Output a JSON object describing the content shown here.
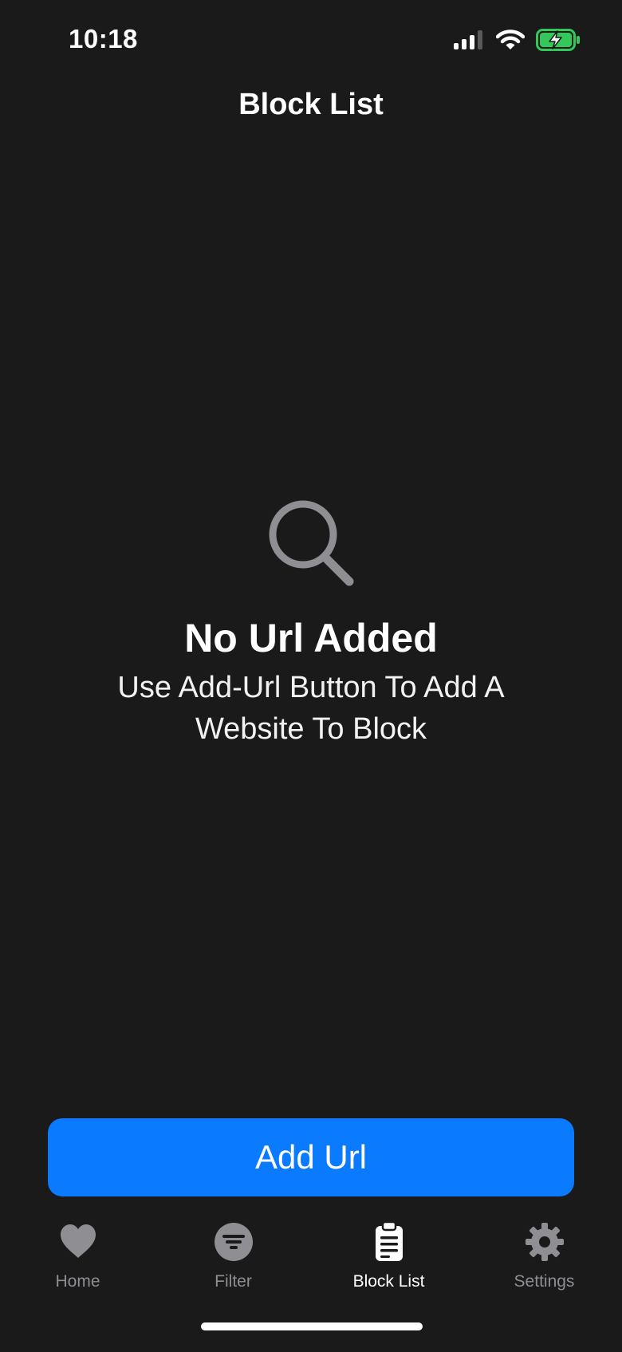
{
  "status_bar": {
    "time": "10:18",
    "icons": [
      "signal-icon",
      "wifi-icon",
      "battery-charging-icon"
    ]
  },
  "header": {
    "title": "Block List"
  },
  "empty_state": {
    "icon": "search-icon",
    "title": "No Url Added",
    "message": "Use Add-Url Button To Add A Website To Block"
  },
  "add_button": {
    "label": "Add Url",
    "color": "#0a7aff"
  },
  "tab_bar": {
    "items": [
      {
        "label": "Home",
        "icon": "heart-icon",
        "active": false
      },
      {
        "label": "Filter",
        "icon": "filter-icon",
        "active": false
      },
      {
        "label": "Block List",
        "icon": "clipboard-icon",
        "active": true
      },
      {
        "label": "Settings",
        "icon": "gear-icon",
        "active": false
      }
    ]
  },
  "colors": {
    "background": "#1a1a1a",
    "inactive_tab": "#8e8e93",
    "battery_green": "#34c759"
  }
}
